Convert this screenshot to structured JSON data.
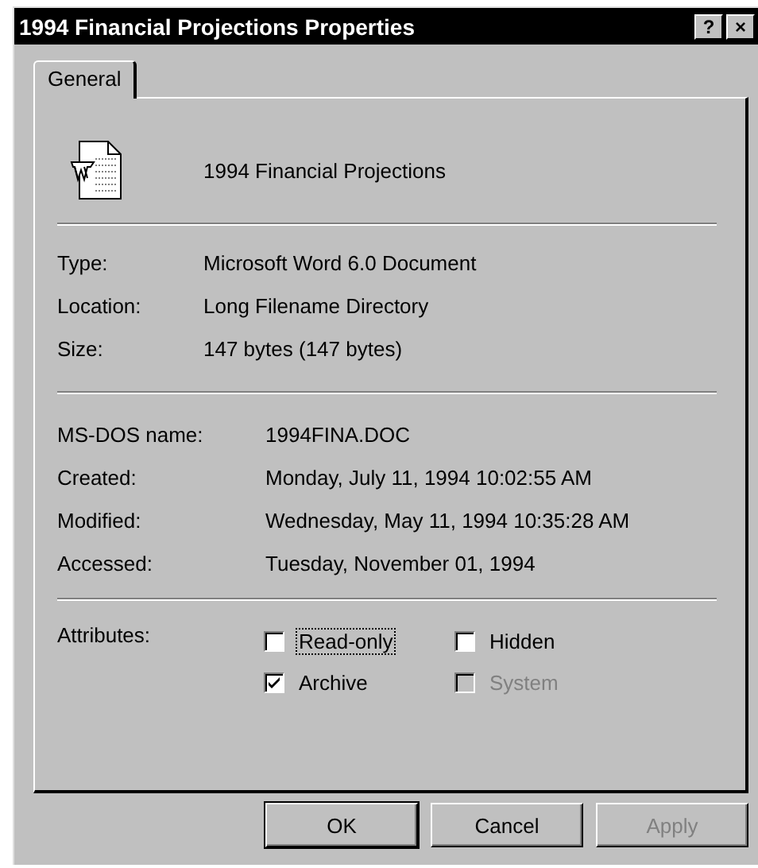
{
  "window": {
    "title": "1994 Financial Projections Properties",
    "title_buttons": [
      "?",
      "×"
    ]
  },
  "tabs": [
    {
      "label": "General",
      "selected": true
    }
  ],
  "file_name": "1994 Financial Projections",
  "details": [
    {
      "label": "Type:",
      "value": "Microsoft Word 6.0 Document"
    },
    {
      "label": "Location:",
      "value": "Long Filename Directory"
    },
    {
      "label": "Size:",
      "value": "147 bytes (147 bytes)"
    }
  ],
  "dates": [
    {
      "label": "MS-DOS name:",
      "value": "1994FINA.DOC"
    },
    {
      "label": "Created:",
      "value": "Monday, July 11, 1994 10:02:55 AM"
    },
    {
      "label": "Modified:",
      "value": "Wednesday, May 11, 1994 10:35:28 AM"
    },
    {
      "label": "Accessed:",
      "value": "Tuesday, November 01, 1994"
    }
  ],
  "attributes": {
    "label": "Attributes:",
    "items": [
      {
        "label": "Read-only",
        "checked": false,
        "disabled": false,
        "focused": true
      },
      {
        "label": "Hidden",
        "checked": false,
        "disabled": false,
        "focused": false
      },
      {
        "label": "Archive",
        "checked": true,
        "disabled": false,
        "focused": false
      },
      {
        "label": "System",
        "checked": false,
        "disabled": true,
        "focused": false
      }
    ]
  },
  "buttons": [
    {
      "label": "OK",
      "disabled": false,
      "default": true
    },
    {
      "label": "Cancel",
      "disabled": false,
      "default": false
    },
    {
      "label": "Apply",
      "disabled": true,
      "default": false
    }
  ]
}
